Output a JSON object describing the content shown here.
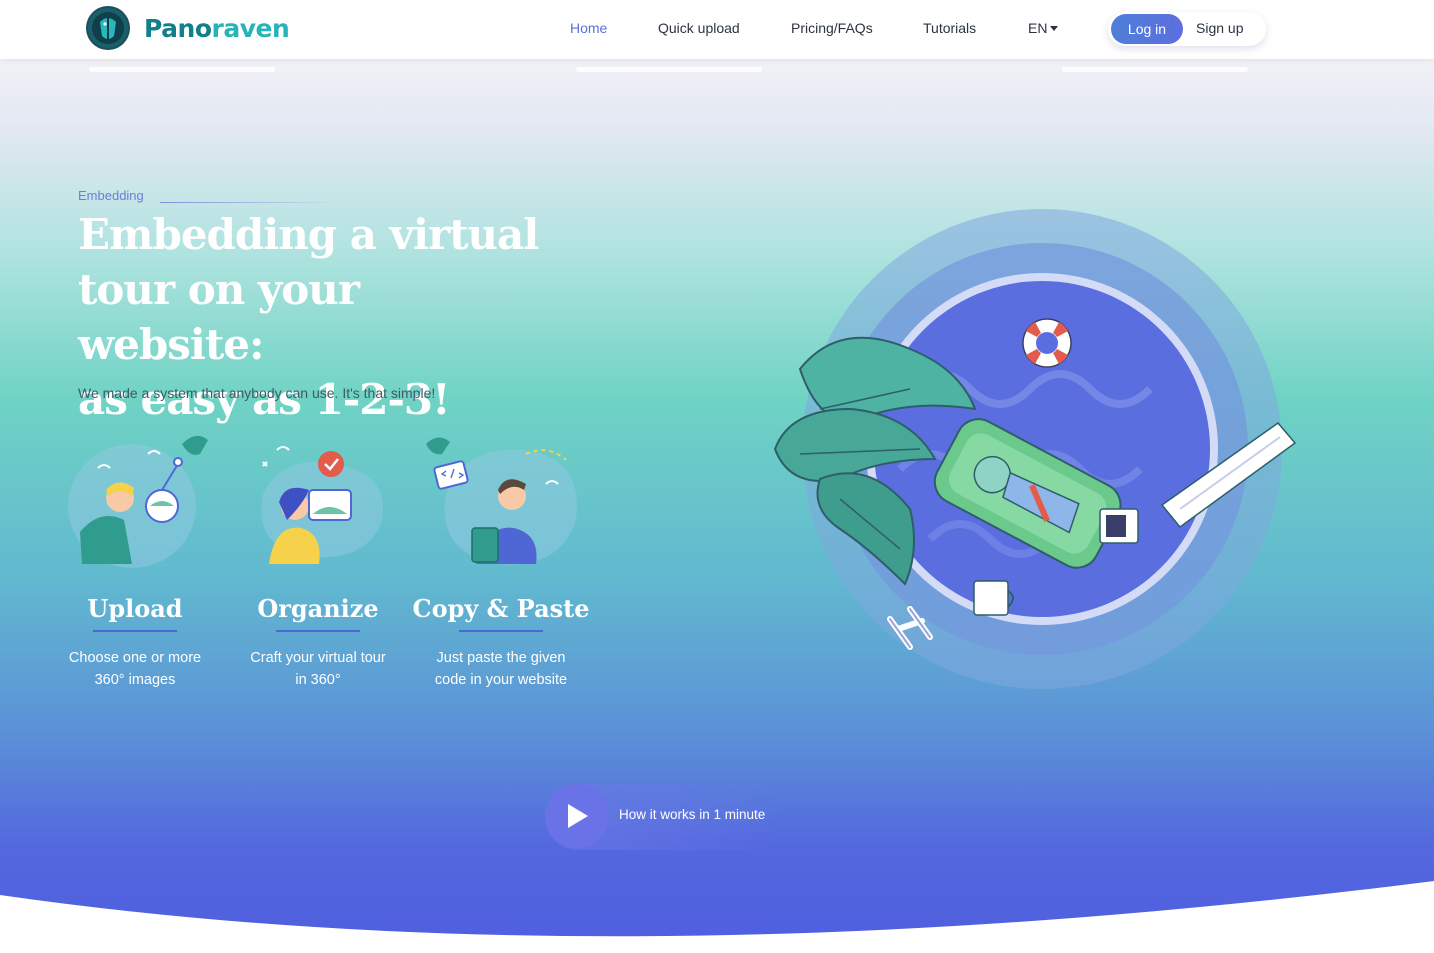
{
  "brand": {
    "name_part1": "Pano",
    "name_part2": "raven"
  },
  "nav": {
    "items": [
      {
        "label": "Home",
        "active": true
      },
      {
        "label": "Quick upload",
        "active": false
      },
      {
        "label": "Pricing/FAQs",
        "active": false
      },
      {
        "label": "Tutorials",
        "active": false
      }
    ],
    "language": "EN",
    "login_label": "Log in",
    "signup_label": "Sign up"
  },
  "hero": {
    "eyebrow": "Embedding",
    "title_line1": "Embedding a virtual",
    "title_line2": "tour on your website:",
    "title_line3": "as easy as 1-2-3!",
    "subtitle": "We made a system that anybody can use. It's that simple!"
  },
  "steps": [
    {
      "title": "Upload",
      "line1": "Choose one or more",
      "line2": "360° images",
      "icon": "upload-illustration"
    },
    {
      "title": "Organize",
      "line1": "Craft your virtual tour",
      "line2": "in 360°",
      "icon": "organize-illustration"
    },
    {
      "title": "Copy & Paste",
      "line1": "Just paste the given",
      "line2": "code in your website",
      "icon": "copy-paste-illustration"
    }
  ],
  "video": {
    "label": "How it works in 1 minute",
    "icon": "play-icon"
  },
  "colors": {
    "accent": "#5c6fd6",
    "brand_dark": "#12808a",
    "brand_light": "#27b3b7",
    "pool_blue": "#5a6ee0"
  }
}
